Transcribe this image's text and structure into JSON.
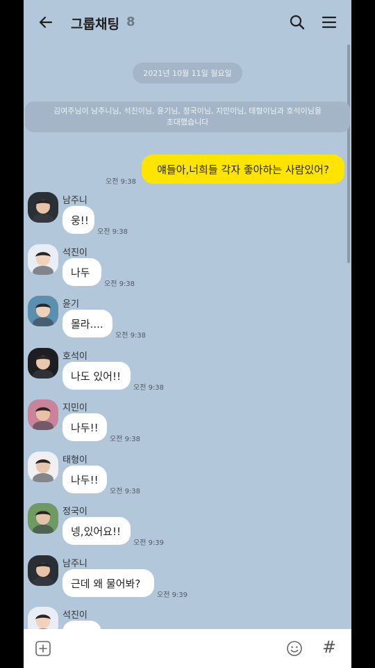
{
  "header": {
    "title": "그룹채팅",
    "member_count": "8",
    "back_icon": "arrow-left-icon",
    "search_icon": "search-icon",
    "menu_icon": "hamburger-menu-icon"
  },
  "date_label": "2021년 10월 11일 월요일",
  "system_message": {
    "line1": "김여주님이 남주니님, 석진이님, 윤기님, 정국이님, 지민이님, 태형이님과 호석이님을",
    "line2": "초대했습니다"
  },
  "my_message": {
    "text": "얘들아,너희들 각자 좋아하는 사람있어?",
    "time": "오전 9:38"
  },
  "messages": [
    {
      "name": "남주니",
      "text": "웅!!",
      "time": "오전 9:38"
    },
    {
      "name": "석진이",
      "text": "나두",
      "time": "오전 9:38"
    },
    {
      "name": "윤기",
      "text": "몰라....",
      "time": "오전 9:38"
    },
    {
      "name": "호석이",
      "text": "나도 있어!!",
      "time": "오전 9:38"
    },
    {
      "name": "지민이",
      "text": "나두!!",
      "time": "오전 9:38"
    },
    {
      "name": "태형이",
      "text": "나두!!",
      "time": "오전 9:38"
    },
    {
      "name": "정국이",
      "text": "넹,있어요!!",
      "time": "오전 9:39"
    },
    {
      "name": "남주니",
      "text": "근데 왜 물어봐?",
      "time": "오전 9:39"
    },
    {
      "name": "석진이",
      "text": "",
      "time": ""
    }
  ],
  "input_bar": {
    "add_icon": "plus-square-icon",
    "emoji_icon": "smiley-icon",
    "hash_label": "#"
  },
  "colors": {
    "chat_background": "#b2c7da",
    "my_bubble": "#fee500",
    "other_bubble": "#ffffff"
  }
}
